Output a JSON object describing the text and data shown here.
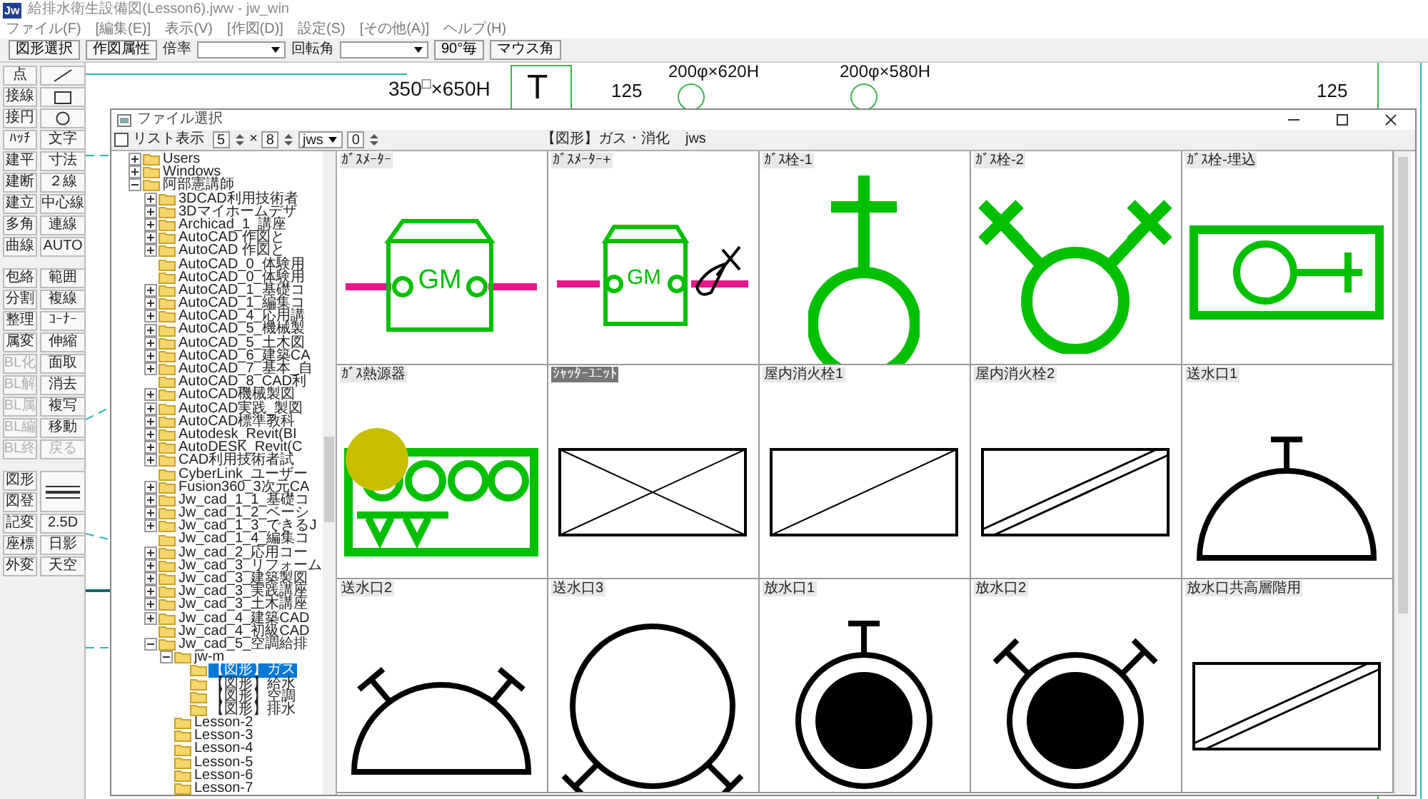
{
  "window": {
    "logo": "Jw",
    "title": "給排水衛生設備図(Lesson6).jww - jw_win"
  },
  "menu": [
    "ファイル(F)",
    "[編集(E)]",
    "表示(V)",
    "[作図(D)]",
    "設定(S)",
    "[その他(A)]",
    "ヘルプ(H)"
  ],
  "toolbar": [
    {
      "kind": "button",
      "label": "図形選択"
    },
    {
      "kind": "button",
      "label": "作図属性"
    },
    {
      "kind": "select",
      "label": "倍率"
    },
    {
      "kind": "select",
      "label": "回転角"
    },
    {
      "kind": "button",
      "label": "90°毎"
    },
    {
      "kind": "button",
      "label": "マウス角"
    }
  ],
  "palette": [
    {
      "left": [
        {
          "label": "点",
          "disabled": false
        },
        {
          "label": "接線",
          "disabled": false
        },
        {
          "label": "接円",
          "disabled": false
        },
        {
          "label": "ﾊｯﾁ",
          "disabled": false
        },
        {
          "label": "建平",
          "disabled": false
        },
        {
          "label": "建断",
          "disabled": false
        },
        {
          "label": "建立",
          "disabled": false
        },
        {
          "label": "多角",
          "disabled": false
        },
        {
          "label": "曲線",
          "disabled": false
        }
      ],
      "right": [
        {
          "kind": "line",
          "disabled": false
        },
        {
          "kind": "rect",
          "disabled": false
        },
        {
          "kind": "circle",
          "disabled": false
        },
        {
          "kind": "text",
          "label": "文字",
          "disabled": false
        },
        {
          "kind": "text",
          "label": "寸法",
          "disabled": false
        },
        {
          "kind": "text",
          "label": "２線",
          "disabled": false
        },
        {
          "kind": "text",
          "label": "中心線",
          "disabled": false
        },
        {
          "kind": "text",
          "label": "連線",
          "disabled": false
        },
        {
          "kind": "text",
          "label": "AUTO",
          "disabled": false
        }
      ]
    },
    {
      "left": [
        {
          "label": "包絡",
          "disabled": false
        },
        {
          "label": "分割",
          "disabled": false
        },
        {
          "label": "整理",
          "disabled": false
        },
        {
          "label": "属変",
          "disabled": false
        },
        {
          "label": "BL化",
          "disabled": true
        },
        {
          "label": "BL解",
          "disabled": true
        },
        {
          "label": "BL属",
          "disabled": true
        },
        {
          "label": "BL編",
          "disabled": true
        },
        {
          "label": "BL終",
          "disabled": true
        }
      ],
      "right": [
        {
          "kind": "text",
          "label": "範囲",
          "disabled": false
        },
        {
          "kind": "text",
          "label": "複線",
          "disabled": false
        },
        {
          "kind": "text",
          "label": "ｺｰﾅｰ",
          "disabled": false
        },
        {
          "kind": "text",
          "label": "伸縮",
          "disabled": false
        },
        {
          "kind": "text",
          "label": "面取",
          "disabled": false
        },
        {
          "kind": "text",
          "label": "消去",
          "disabled": false
        },
        {
          "kind": "text",
          "label": "複写",
          "disabled": false
        },
        {
          "kind": "text",
          "label": "移動",
          "disabled": false
        },
        {
          "kind": "text",
          "label": "戻る",
          "disabled": true
        }
      ]
    },
    {
      "left": [
        {
          "label": "図形",
          "disabled": false
        },
        {
          "label": "図登",
          "disabled": false
        },
        {
          "label": "記変",
          "disabled": false
        },
        {
          "label": "座標",
          "disabled": false
        },
        {
          "label": "外変",
          "disabled": false
        }
      ],
      "right": [
        {
          "kind": "linestyle",
          "disabled": false
        },
        {
          "kind": "text",
          "label": "2.5D",
          "disabled": false
        },
        {
          "kind": "text",
          "label": "日影",
          "disabled": false
        },
        {
          "kind": "text",
          "label": "天空",
          "disabled": false
        }
      ]
    }
  ],
  "drawing": {
    "texts": [
      "350$^{□}$×650H",
      "T",
      "125",
      "200φ×620H",
      "200φ×580H",
      "125"
    ]
  },
  "dialog": {
    "title": "ファイル選択",
    "list_view": {
      "label": "リスト表示",
      "checked": false
    },
    "columns": "5",
    "times": "×",
    "rows": "8",
    "extension": "jws",
    "spin": "0",
    "path": "【図形】ガス・消化",
    "path_ext": "jws",
    "tree": [
      {
        "label": "Users",
        "expanded": false,
        "selected": false
      },
      {
        "label": "Windows",
        "expanded": false,
        "selected": false
      },
      {
        "label": "阿部憲講師",
        "expanded": true,
        "selected": false,
        "children": [
          {
            "label": "3DCAD利用技術者",
            "expanded": false,
            "selected": false
          },
          {
            "label": "3Dマイホームデザ",
            "expanded": false,
            "selected": false
          },
          {
            "label": "Archicad_1_講座",
            "expanded": false,
            "selected": false
          },
          {
            "label": "AutoCAD 作図と",
            "expanded": false,
            "selected": false
          },
          {
            "label": "AutoCAD 作図と",
            "expanded": false,
            "selected": false
          },
          {
            "label": "AutoCAD_0_体験用",
            "selected": false
          },
          {
            "label": "AutoCAD_0_体験用",
            "selected": false
          },
          {
            "label": "AutoCAD_1_基礎コ",
            "expanded": false,
            "selected": false
          },
          {
            "label": "AutoCAD_1_編集コ",
            "expanded": false,
            "selected": false
          },
          {
            "label": "AutoCAD_4_応用講",
            "expanded": false,
            "selected": false
          },
          {
            "label": "AutoCAD_5_機械製",
            "expanded": false,
            "selected": false
          },
          {
            "label": "AutoCAD_5_土木図",
            "expanded": false,
            "selected": false
          },
          {
            "label": "AutoCAD_6_建築CA",
            "expanded": false,
            "selected": false
          },
          {
            "label": "AutoCAD_7_基本_自",
            "expanded": false,
            "selected": false
          },
          {
            "label": "AutoCAD_8_CAD利",
            "selected": false
          },
          {
            "label": "AutoCAD機械製図",
            "expanded": false,
            "selected": false
          },
          {
            "label": "AutoCAD実践_製図",
            "expanded": false,
            "selected": false
          },
          {
            "label": "AutoCAD標準教科",
            "expanded": false,
            "selected": false
          },
          {
            "label": "Autodesk_Revit(BI",
            "expanded": false,
            "selected": false
          },
          {
            "label": "AutoDESK_Revit(C",
            "expanded": false,
            "selected": false
          },
          {
            "label": "CAD利用技術者試",
            "expanded": false,
            "selected": false
          },
          {
            "label": "CyberLink_ユーザー",
            "selected": false
          },
          {
            "label": "Fusion360_3次元CA",
            "expanded": false,
            "selected": false
          },
          {
            "label": "Jw_cad_1_1_基礎コ",
            "expanded": false,
            "selected": false
          },
          {
            "label": "Jw_cad_1_2_ベーシ",
            "expanded": false,
            "selected": false
          },
          {
            "label": "Jw_cad_1_3_できるJ",
            "expanded": false,
            "selected": false
          },
          {
            "label": "Jw_cad_1_4_編集コ",
            "selected": false
          },
          {
            "label": "Jw_cad_2_応用コー",
            "expanded": false,
            "selected": false
          },
          {
            "label": "Jw_cad_3_リフォーム",
            "expanded": false,
            "selected": false
          },
          {
            "label": "Jw_cad_3_建築製図",
            "expanded": false,
            "selected": false
          },
          {
            "label": "Jw_cad_3_実践講座",
            "expanded": false,
            "selected": false
          },
          {
            "label": "Jw_cad_3_土木講座",
            "expanded": false,
            "selected": false
          },
          {
            "label": "Jw_cad_4_建築CAD",
            "expanded": false,
            "selected": false
          },
          {
            "label": "Jw_cad_4_初級CAD",
            "selected": false
          },
          {
            "label": "Jw_cad_5_空調給排",
            "expanded": true,
            "selected": false,
            "children": [
              {
                "label": "jw-m",
                "expanded": true,
                "selected": false,
                "children": [
                  {
                    "label": "【図形】ガス",
                    "selected": true
                  },
                  {
                    "label": "【図形】給水",
                    "selected": false
                  },
                  {
                    "label": "【図形】空調",
                    "selected": false
                  },
                  {
                    "label": "【図形】排水",
                    "selected": false
                  }
                ]
              },
              {
                "label": "Lesson-2",
                "selected": false
              },
              {
                "label": "Lesson-3",
                "selected": false
              },
              {
                "label": "Lesson-4",
                "selected": false
              },
              {
                "label": "Lesson-5",
                "selected": false
              },
              {
                "label": "Lesson-6",
                "selected": false
              },
              {
                "label": "Lesson-7",
                "selected": false
              }
            ]
          }
        ]
      }
    ],
    "cells": [
      {
        "label": "ｶﾞｽﾒｰﾀｰ",
        "kind": "meter",
        "text": "GM",
        "selected": false,
        "cursor": false
      },
      {
        "label": "ｶﾞｽﾒｰﾀｰ+",
        "kind": "meterplus",
        "text": "GM",
        "selected": false,
        "cursor": false
      },
      {
        "label": "ｶﾞｽ栓-1",
        "kind": "tap1",
        "selected": false,
        "cursor": false
      },
      {
        "label": "ｶﾞｽ栓-2",
        "kind": "tap2",
        "selected": false,
        "cursor": false
      },
      {
        "label": "ｶﾞｽ栓-埋込",
        "kind": "tapbox",
        "selected": false,
        "cursor": false
      },
      {
        "label": "ｶﾞｽ熱源器",
        "kind": "heater",
        "selected": false,
        "cursor": true
      },
      {
        "label": "ｼｬｯﾀｰﾕﾆｯﾄ",
        "kind": "xbox",
        "selected": true,
        "cursor": false
      },
      {
        "label": "屋内消火栓1",
        "kind": "diagbox",
        "selected": false,
        "cursor": false
      },
      {
        "label": "屋内消火栓2",
        "kind": "doublediag",
        "selected": false,
        "cursor": false
      },
      {
        "label": "送水口1",
        "kind": "dome",
        "selected": false,
        "cursor": false
      },
      {
        "label": "送水口2",
        "kind": "dome2",
        "selected": false,
        "cursor": false
      },
      {
        "label": "送水口3",
        "kind": "ring",
        "selected": false,
        "cursor": false
      },
      {
        "label": "放水口1",
        "kind": "hydrant",
        "selected": false,
        "cursor": false
      },
      {
        "label": "放水口2",
        "kind": "hydrant2",
        "selected": false,
        "cursor": false
      },
      {
        "label": "放水口共高層階用",
        "kind": "doublediag",
        "selected": false,
        "cursor": false
      }
    ]
  }
}
